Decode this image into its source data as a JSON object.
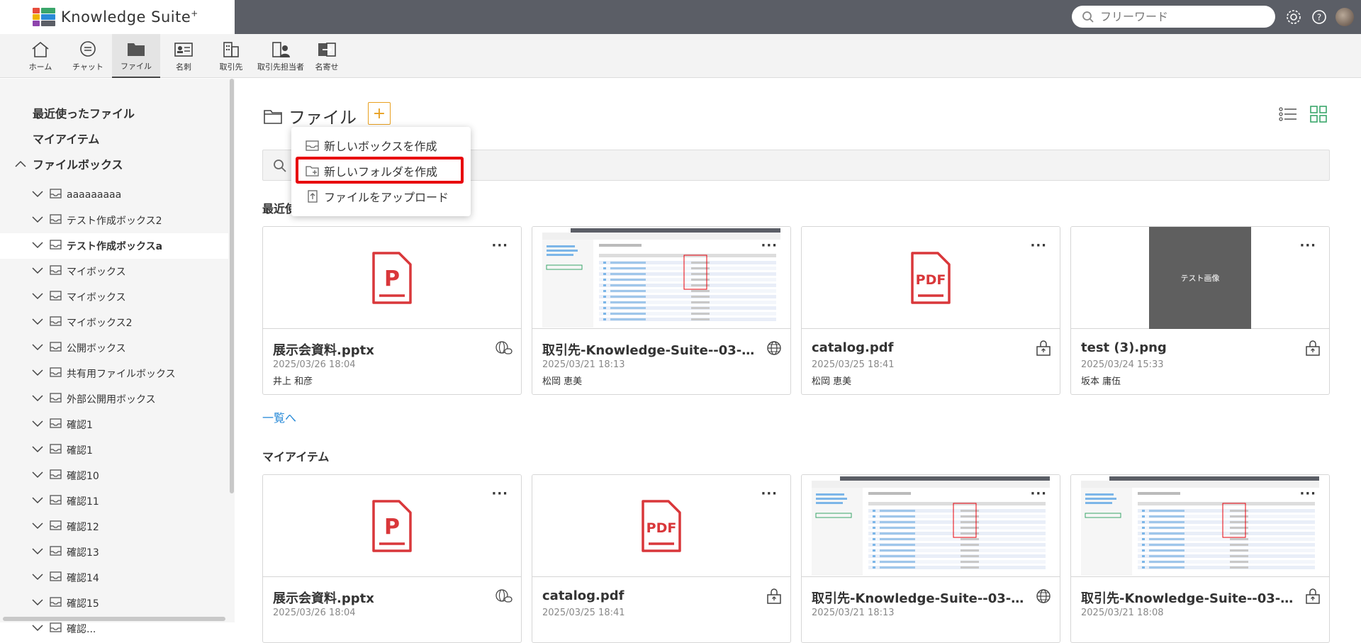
{
  "header": {
    "brand_name": "Knowledge Suite",
    "brand_mark": "+",
    "search_placeholder": "フリーワード",
    "icons": [
      "search-icon",
      "gear-icon",
      "help-icon",
      "avatar"
    ]
  },
  "nav": {
    "items": [
      {
        "label": "ホーム",
        "icon": "home-icon"
      },
      {
        "label": "チャット",
        "icon": "chat-icon"
      },
      {
        "label": "ファイル",
        "icon": "folder-icon",
        "active": true
      },
      {
        "label": "名刺",
        "icon": "business-card-icon"
      },
      {
        "label": "取引先",
        "icon": "building-icon"
      },
      {
        "label": "取引先担当者",
        "icon": "contact-person-icon"
      },
      {
        "label": "名寄せ",
        "icon": "merge-icon"
      }
    ]
  },
  "sidebar": {
    "recent": "最近使ったファイル",
    "my_items": "マイアイテム",
    "file_boxes": "ファイルボックス",
    "boxes": [
      {
        "label": "aaaaaaaaa"
      },
      {
        "label": "テスト作成ボックス2"
      },
      {
        "label": "テスト作成ボックスa",
        "selected": true
      },
      {
        "label": "マイボックス"
      },
      {
        "label": "マイボックス"
      },
      {
        "label": "マイボックス2"
      },
      {
        "label": "公開ボックス"
      },
      {
        "label": "共有用ファイルボックス"
      },
      {
        "label": "外部公開用ボックス"
      },
      {
        "label": "確認1"
      },
      {
        "label": "確認1"
      },
      {
        "label": "確認10"
      },
      {
        "label": "確認11"
      },
      {
        "label": "確認12"
      },
      {
        "label": "確認13"
      },
      {
        "label": "確認14"
      },
      {
        "label": "確認15"
      },
      {
        "label": "確認..."
      }
    ]
  },
  "main": {
    "title": "ファイル",
    "add_label": "+",
    "recent_section": "最近使ったファイル",
    "recent_section_visible": "最近使",
    "more_link": "一覧へ",
    "my_items_section": "マイアイテム",
    "dropdown": {
      "items": [
        {
          "label": "新しいボックスを作成",
          "icon": "new-box-icon"
        },
        {
          "label": "新しいフォルダを作成",
          "icon": "new-folder-icon",
          "highlighted": true
        },
        {
          "label": "ファイルをアップロード",
          "icon": "upload-icon"
        }
      ]
    },
    "recent_files": [
      {
        "name": "展示会資料.pptx",
        "date": "2025/03/26 18:04",
        "owner": "井上 和彦",
        "thumb": "pptx",
        "badge": "share-link-icon"
      },
      {
        "name": "取引先-Knowledge-Suite--03-21...",
        "date": "2025/03/21 18:13",
        "owner": "松岡 恵美",
        "thumb": "screenshot",
        "badge": "globe-icon"
      },
      {
        "name": "catalog.pdf",
        "date": "2025/03/25 18:41",
        "owner": "松岡 恵美",
        "thumb": "pdf",
        "badge": "lock-icon"
      },
      {
        "name": "test (3).png",
        "date": "2025/03/24 15:33",
        "owner": "坂本 庸伍",
        "thumb": "image",
        "image_text": "テスト画像",
        "badge": "lock-icon"
      }
    ],
    "my_files": [
      {
        "name": "展示会資料.pptx",
        "date": "2025/03/26 18:04",
        "thumb": "pptx",
        "badge": "share-link-icon"
      },
      {
        "name": "catalog.pdf",
        "date": "2025/03/25 18:41",
        "thumb": "pdf",
        "badge": "lock-icon"
      },
      {
        "name": "取引先-Knowledge-Suite--03-21...",
        "date": "2025/03/21 18:13",
        "thumb": "screenshot",
        "badge": "globe-icon"
      },
      {
        "name": "取引先-Knowledge-Suite--03-21...",
        "date": "2025/03/21 18:08",
        "thumb": "screenshot",
        "badge": "lock-icon"
      }
    ],
    "pdf_label": "PDF",
    "pptx_label": "P",
    "more_dots": "···"
  },
  "colors": {
    "header_bg": "#5b5e66",
    "accent_orange": "#e8a020",
    "file_red": "#d9373a",
    "link_blue": "#2a8bd8",
    "highlight_red": "#e8000a",
    "grid_green": "#3aa66a"
  }
}
